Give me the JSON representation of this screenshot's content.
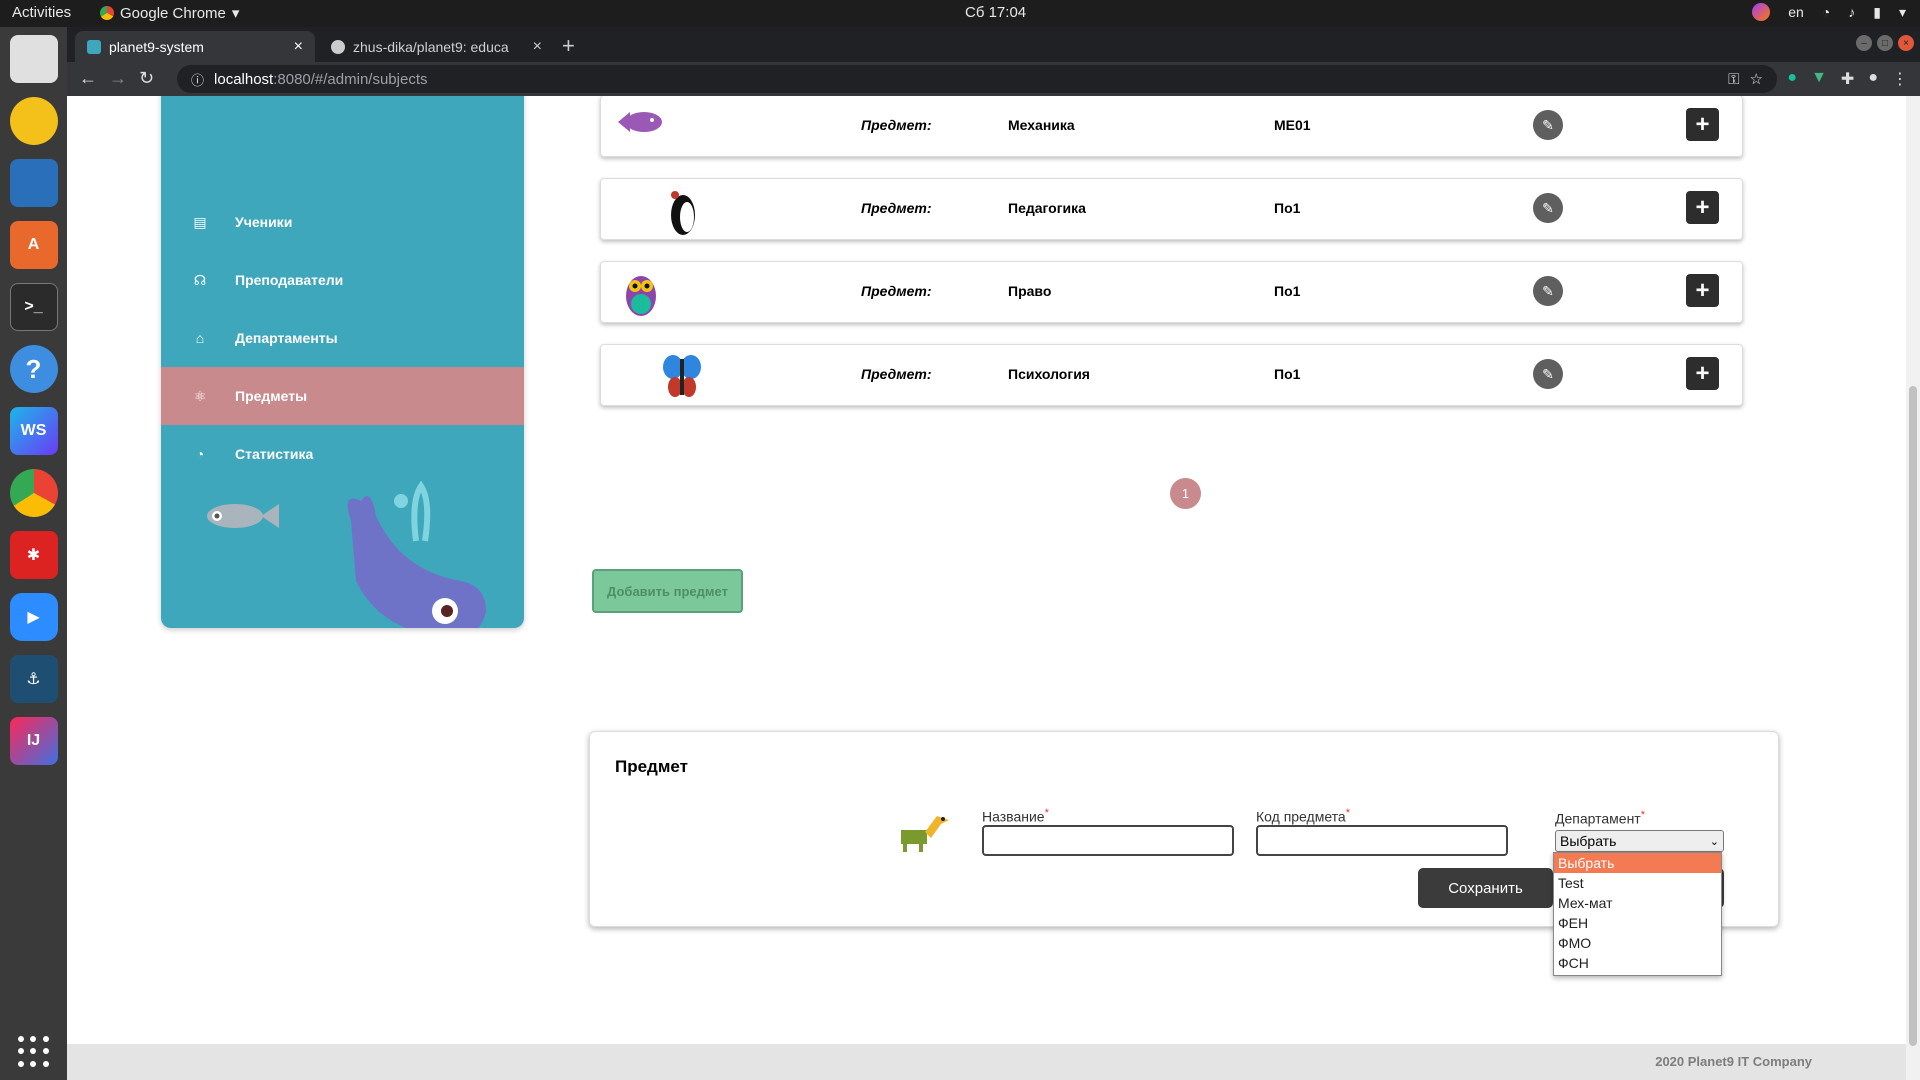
{
  "os": {
    "activities": "Activities",
    "app_name": "Google Chrome",
    "clock": "Сб 17:04",
    "lang": "en"
  },
  "browser": {
    "tabs": [
      {
        "title": "planet9-system"
      },
      {
        "title": "zhus-dika/planet9: educa"
      }
    ],
    "url_host": "localhost",
    "url_path": ":8080/#/admin/subjects"
  },
  "sidebar": {
    "items": [
      {
        "label": "Ученики"
      },
      {
        "label": "Преподаватели"
      },
      {
        "label": "Департаменты"
      },
      {
        "label": "Предметы"
      },
      {
        "label": "Статистика"
      }
    ],
    "colors": {
      "bg": "#3fa7bb",
      "active": "#c88a8c"
    }
  },
  "subjects": {
    "label": "Предмет:",
    "rows": [
      {
        "name": "Механика",
        "code": "ME01",
        "icon": "fish-icon"
      },
      {
        "name": "Педагогика",
        "code": "По1",
        "icon": "penguin-icon"
      },
      {
        "name": "Право",
        "code": "По1",
        "icon": "owl-icon"
      },
      {
        "name": "Психология",
        "code": "По1",
        "icon": "butterfly-icon"
      }
    ]
  },
  "pagination": {
    "current": "1"
  },
  "add_button": "Добавить предмет",
  "form": {
    "title": "Предмет",
    "name_label": "Название",
    "code_label": "Код предмета",
    "department_label": "Департамент",
    "required_mark": "*",
    "select_value": "Выбрать",
    "save_label": "Сохранить",
    "options": [
      "Выбрать",
      "Test",
      "Мех-мат",
      "ФЕН",
      "ФМО",
      "ФСН"
    ]
  },
  "footer": {
    "text": "2020 Planet9 IT Company"
  }
}
